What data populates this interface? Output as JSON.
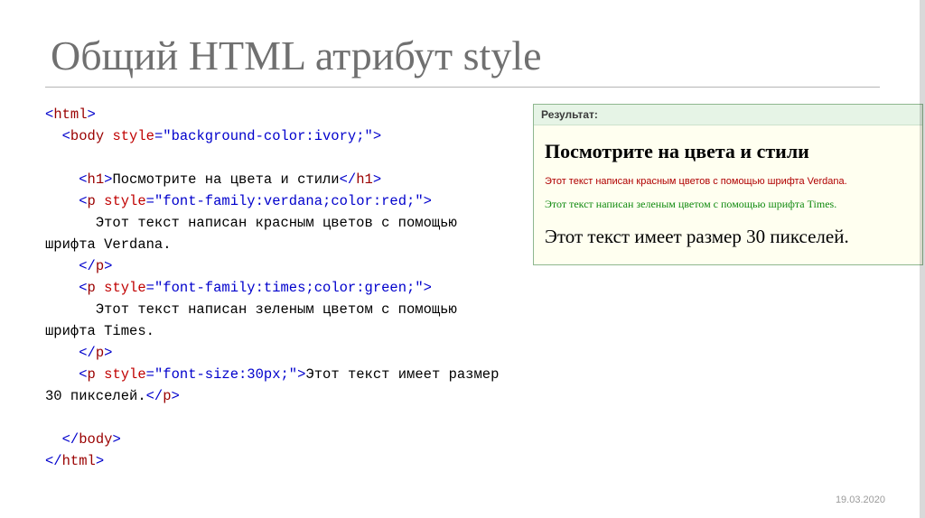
{
  "title": "Общий HTML атрибут style",
  "code": {
    "t1": "html",
    "t2": "body",
    "a_style": "style",
    "v_body": "\"background-color:ivory;\"",
    "t3": "h1",
    "h1_text": "Посмотрите на цвета и стили",
    "t4": "p",
    "v_p1": "\"font-family:verdana;color:red;\"",
    "p1_text": "      Этот текст написан красным цветов с помощью шрифта Verdana.",
    "v_p2": "\"font-family:times;color:green;\"",
    "p2_text": "      Этот текст написан зеленым цветом с помощью шрифта Times.",
    "v_p3": "\"font-size:30px;\"",
    "p3_text": "Этот текст имеет размер 30 пикселей.",
    "lit_word": "размер 30 пикселей."
  },
  "result": {
    "header": "Результат:",
    "h1": "Посмотрите на цвета и стили",
    "red_line": "Этот текст написан красным цветов с помощью шрифта Verdana.",
    "green_line": "Этот текст написан зеленым цветом с помощью шрифта Times.",
    "big_line": "Этот текст имеет размер 30 пикселей."
  },
  "footer_date": "19.03.2020"
}
